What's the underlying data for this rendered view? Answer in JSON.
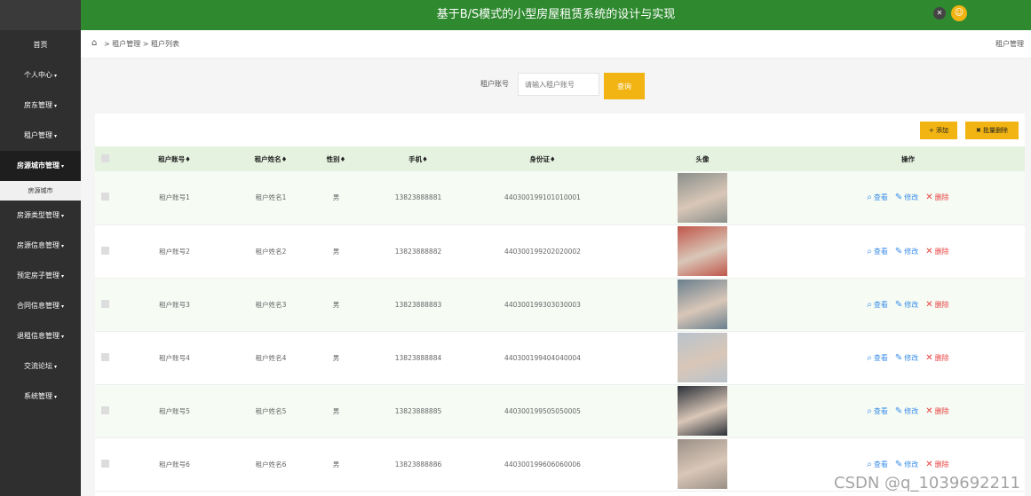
{
  "header": {
    "title": "基于B/S模式的小型房屋租赁系统的设计与实现"
  },
  "sidebar": {
    "items": [
      {
        "label": "首页",
        "caret": ""
      },
      {
        "label": "个人中心",
        "caret": "▾"
      },
      {
        "label": "房东管理",
        "caret": "▾"
      },
      {
        "label": "租户管理",
        "caret": "▾"
      },
      {
        "label": "房源城市管理",
        "caret": "▾"
      },
      {
        "label": "房源类型管理",
        "caret": "▾"
      },
      {
        "label": "房源信息管理",
        "caret": "▾"
      },
      {
        "label": "预定房子管理",
        "caret": "▾"
      },
      {
        "label": "合同信息管理",
        "caret": "▾"
      },
      {
        "label": "退租信息管理",
        "caret": "▾"
      },
      {
        "label": "交流论坛",
        "caret": "▾"
      },
      {
        "label": "系统管理",
        "caret": "▾"
      }
    ],
    "sub_item": "房源城市"
  },
  "breadcrumb": {
    "text": "> 租户管理 > 租户列表",
    "right": "租户管理"
  },
  "search": {
    "label": "租户账号",
    "placeholder": "请输入租户账号",
    "button": "查询"
  },
  "toolbar": {
    "add": "+ 添加",
    "batch_delete": "✖ 批量删除"
  },
  "table": {
    "headers": [
      "租户账号♦",
      "租户姓名♦",
      "性别♦",
      "手机♦",
      "身份证♦",
      "头像",
      "操作"
    ],
    "rows": [
      {
        "account": "租户账号1",
        "name": "租户姓名1",
        "gender": "男",
        "phone": "13823888881",
        "idcard": "440300199101010001"
      },
      {
        "account": "租户账号2",
        "name": "租户姓名2",
        "gender": "男",
        "phone": "13823888882",
        "idcard": "440300199202020002"
      },
      {
        "account": "租户账号3",
        "name": "租户姓名3",
        "gender": "男",
        "phone": "13823888883",
        "idcard": "440300199303030003"
      },
      {
        "account": "租户账号4",
        "name": "租户姓名4",
        "gender": "男",
        "phone": "13823888884",
        "idcard": "440300199404040004"
      },
      {
        "account": "租户账号5",
        "name": "租户姓名5",
        "gender": "男",
        "phone": "13823888885",
        "idcard": "440300199505050005"
      },
      {
        "account": "租户账号6",
        "name": "租户姓名6",
        "gender": "男",
        "phone": "13823888886",
        "idcard": "440300199606060006"
      }
    ],
    "ops": {
      "view": "查看",
      "edit": "修改",
      "delete": "删除"
    }
  },
  "watermark": "CSDN @q_1039692211",
  "colors": {
    "header": "#2f8a2f",
    "accent": "#f1b413",
    "sidebar": "#2f2f2f",
    "table_head": "#e5f2e0"
  }
}
